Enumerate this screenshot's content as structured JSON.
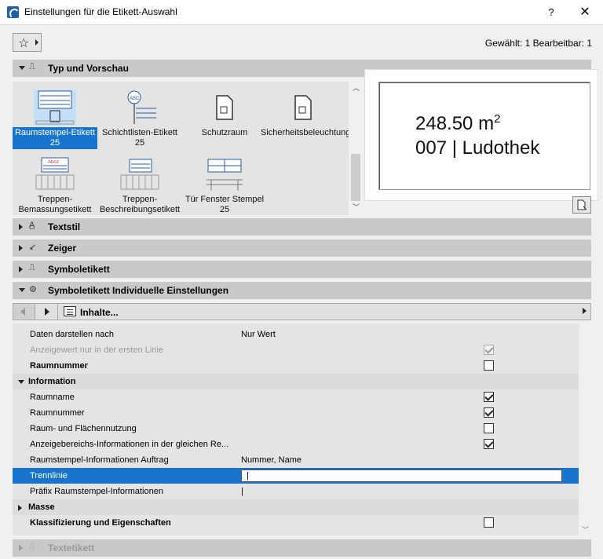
{
  "window": {
    "title": "Einstellungen für die Etikett-Auswahl",
    "help": "?",
    "close": "✕"
  },
  "header": {
    "selection_info": "Gewählt: 1 Bearbeitbar: 1"
  },
  "sections": {
    "typ_vorschau": "Typ und Vorschau",
    "textstil": "Textstil",
    "zeiger": "Zeiger",
    "symboletikett": "Symboletikett",
    "symbol_individuell": "Symboletikett Individuelle Einstellungen",
    "textetikett": "Textetikett"
  },
  "gallery": {
    "items": [
      {
        "label": "Raumstempel-Etikett 25",
        "selected": true
      },
      {
        "label": "Schichtlisten-Etikett 25",
        "selected": false
      },
      {
        "label": "Schutzraum",
        "selected": false
      },
      {
        "label": "Sicherheitsbeleuchtungsetikett",
        "selected": false
      },
      {
        "label": "Treppen-Bemassungsetikett 25",
        "selected": false
      },
      {
        "label": "Treppen-Beschreibungsetikett 25",
        "selected": false
      },
      {
        "label": "Tür Fenster Stempel 25",
        "selected": false
      }
    ]
  },
  "preview": {
    "area": "248.50 m",
    "sup": "2",
    "room": "007 | Ludothek"
  },
  "toolbar": {
    "content_label": "Inhalte..."
  },
  "rows": [
    {
      "name": "Daten darstellen nach",
      "value": "Nur Wert"
    },
    {
      "name": "Anzeigewert nur in der ersten Linie",
      "checkbox": "disabled-checked"
    },
    {
      "name": "Raumnummer",
      "checkbox": "unchecked"
    },
    {
      "name": "Information",
      "group": true
    },
    {
      "name": "Raumname",
      "checkbox": "checked"
    },
    {
      "name": "Raumnummer",
      "checkbox": "checked"
    },
    {
      "name": "Raum- und Flächennutzung",
      "checkbox": "unchecked"
    },
    {
      "name": "Anzeigebereichs-Informationen in der gleichen Re...",
      "checkbox": "checked"
    },
    {
      "name": "Raumstempel-Informationen Auftrag",
      "value": "Nummer, Name"
    },
    {
      "name": "Trennlinie",
      "input": "|"
    },
    {
      "name": "Präfix Raumstempel-Informationen",
      "value": "|"
    },
    {
      "name": "Masse",
      "group": true,
      "collapsed": true
    },
    {
      "name": "Klassifizierung und Eigenschaften",
      "checkbox": "unchecked"
    }
  ],
  "colors": {
    "accent": "#1874cd",
    "section_bg": "#c9c9c9",
    "panel_bg": "#e4e4e4"
  },
  "icons": [
    "star-icon",
    "dropdown-icon",
    "label-type-icon",
    "textstyle-icon",
    "pointer-icon",
    "symbol-label-icon",
    "list-icon"
  ]
}
